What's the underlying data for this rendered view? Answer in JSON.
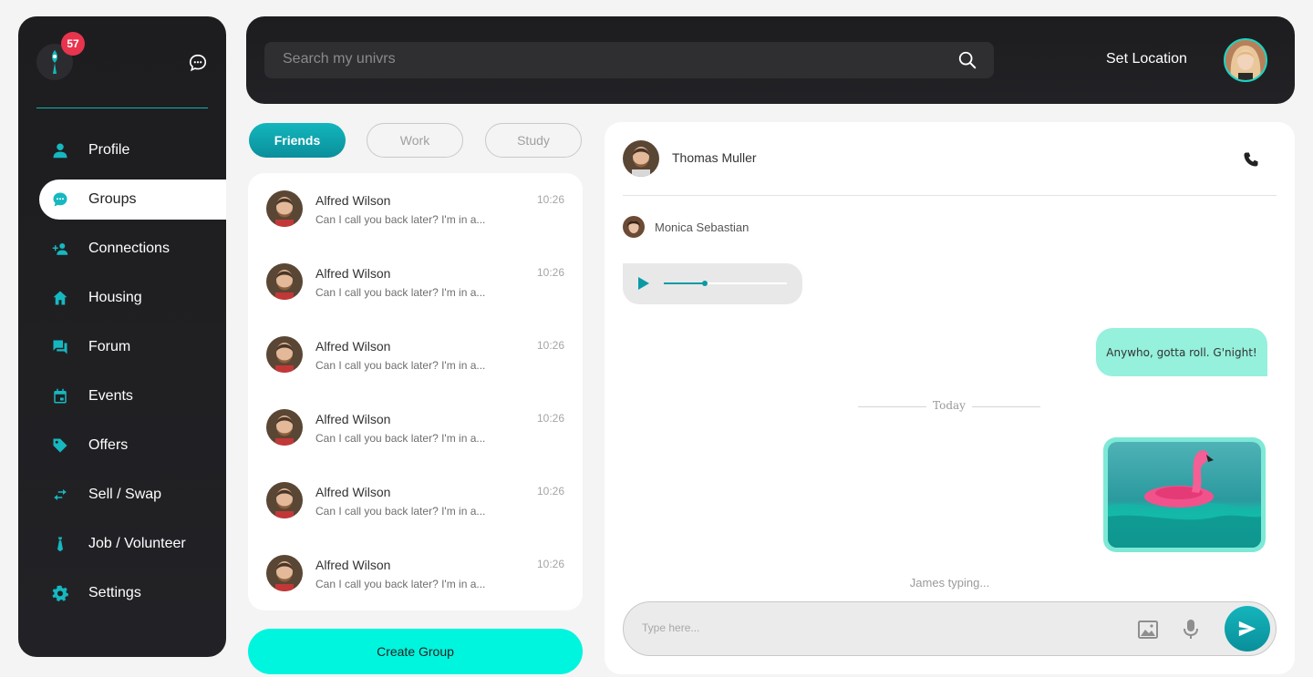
{
  "sidebar": {
    "notification_count": "57",
    "items": [
      {
        "label": "Profile",
        "icon": "person-icon"
      },
      {
        "label": "Groups",
        "icon": "chat-bubble-icon",
        "active": true
      },
      {
        "label": "Connections",
        "icon": "add-person-icon"
      },
      {
        "label": "Housing",
        "icon": "home-icon"
      },
      {
        "label": "Forum",
        "icon": "forum-icon"
      },
      {
        "label": "Events",
        "icon": "calendar-icon"
      },
      {
        "label": "Offers",
        "icon": "tag-icon"
      },
      {
        "label": "Sell / Swap",
        "icon": "swap-icon"
      },
      {
        "label": "Job / Volunteer",
        "icon": "tie-icon"
      },
      {
        "label": "Settings",
        "icon": "gear-icon"
      }
    ]
  },
  "header": {
    "search_placeholder": "Search my univrs",
    "set_location": "Set Location"
  },
  "tabs": [
    {
      "label": "Friends",
      "active": true
    },
    {
      "label": "Work",
      "active": false
    },
    {
      "label": "Study",
      "active": false
    }
  ],
  "conversations": [
    {
      "name": "Alfred Wilson",
      "message": "Can I call you back later? I'm in a...",
      "time": "10:26"
    },
    {
      "name": "Alfred Wilson",
      "message": "Can I call you back later? I'm in a...",
      "time": "10:26"
    },
    {
      "name": "Alfred Wilson",
      "message": "Can I call you back later? I'm in a...",
      "time": "10:26"
    },
    {
      "name": "Alfred Wilson",
      "message": "Can I call you back later? I'm in a...",
      "time": "10:26"
    },
    {
      "name": "Alfred Wilson",
      "message": "Can I call you back later? I'm in a...",
      "time": "10:26"
    },
    {
      "name": "Alfred Wilson",
      "message": "Can I call you back later? I'm in a...",
      "time": "10:26"
    }
  ],
  "create_group_label": "Create Group",
  "chat": {
    "contact_name": "Thomas Muller",
    "sender_name": "Monica Sebastian",
    "audio_progress": 0.33,
    "outgoing_message": "Anywho, gotta roll. G'night!",
    "date_separator": "Today",
    "typing_status": "James typing...",
    "compose_placeholder": "Type here..."
  },
  "colors": {
    "accent": "#0a9aa4",
    "create_button": "#00f5de",
    "outgoing_bubble": "#95f0dc",
    "badge": "#e8344d"
  }
}
